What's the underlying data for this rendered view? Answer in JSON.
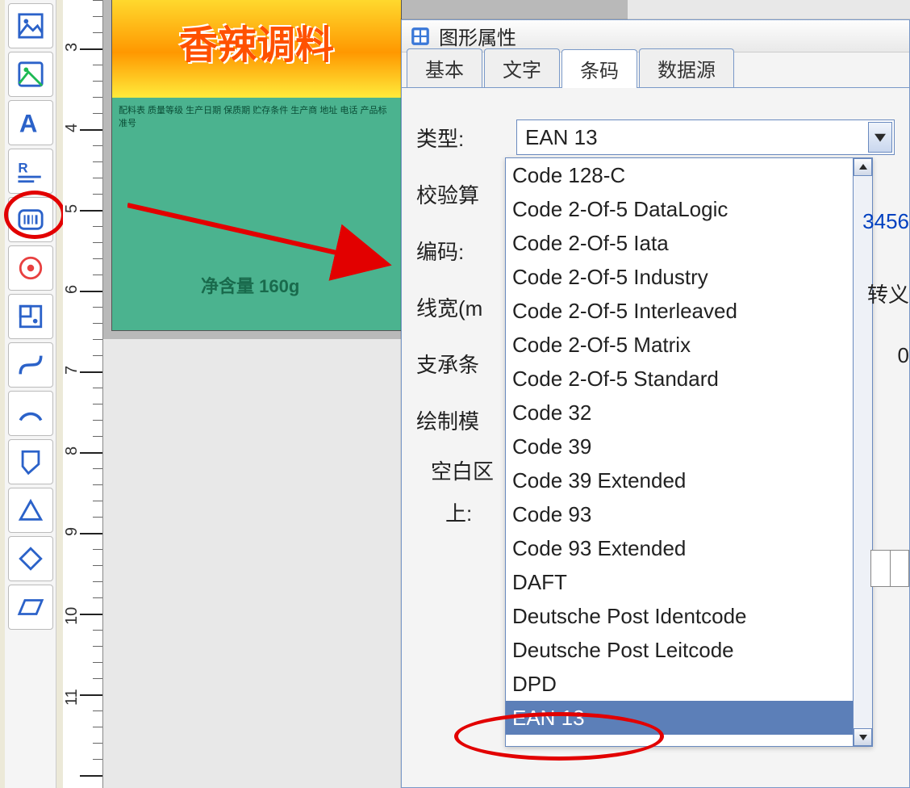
{
  "dialog": {
    "title": "图形属性",
    "tabs": [
      "基本",
      "文字",
      "条码",
      "数据源"
    ],
    "active_tab": "条码",
    "labels": {
      "type": "类型:",
      "check": "校验算",
      "encode": "编码:",
      "linewidth": "线宽(m",
      "bearer": "支承条",
      "drawmode": "绘制模",
      "quiet": "空白区",
      "top": "上:"
    },
    "type_value": "EAN 13",
    "dropdown": [
      "Code 128-C",
      "Code 2-Of-5 DataLogic",
      "Code 2-Of-5 Iata",
      "Code 2-Of-5 Industry",
      "Code 2-Of-5 Interleaved",
      "Code 2-Of-5 Matrix",
      "Code 2-Of-5 Standard",
      "Code 32",
      "Code 39",
      "Code 39 Extended",
      "Code 93",
      "Code 93 Extended",
      "DAFT",
      "Deutsche Post Identcode",
      "Deutsche Post Leitcode",
      "DPD",
      "EAN 13"
    ],
    "selected_option": "EAN 13",
    "right_fragments": {
      "f1": "3456",
      "f2": "转义",
      "f3": "0"
    }
  },
  "canvas": {
    "hero_text": "香辣调料",
    "weight": "净含量 160g",
    "filler": "配料表 质量等级 生产日期 保质期 贮存条件 生产商 地址 电话 产品标准号"
  },
  "ruler": {
    "marks": [
      "3",
      "4",
      "5",
      "6",
      "7",
      "8",
      "9",
      "10",
      "11"
    ]
  },
  "toolbar": {
    "items": [
      "picture-frame-icon",
      "image-icon",
      "text-icon",
      "rich-text-icon",
      "barcode-icon",
      "qrcode-icon",
      "table-grid-icon",
      "bezier-icon",
      "arc-icon",
      "polygon-icon",
      "triangle-icon",
      "diamond-icon",
      "parallelogram-icon"
    ]
  }
}
